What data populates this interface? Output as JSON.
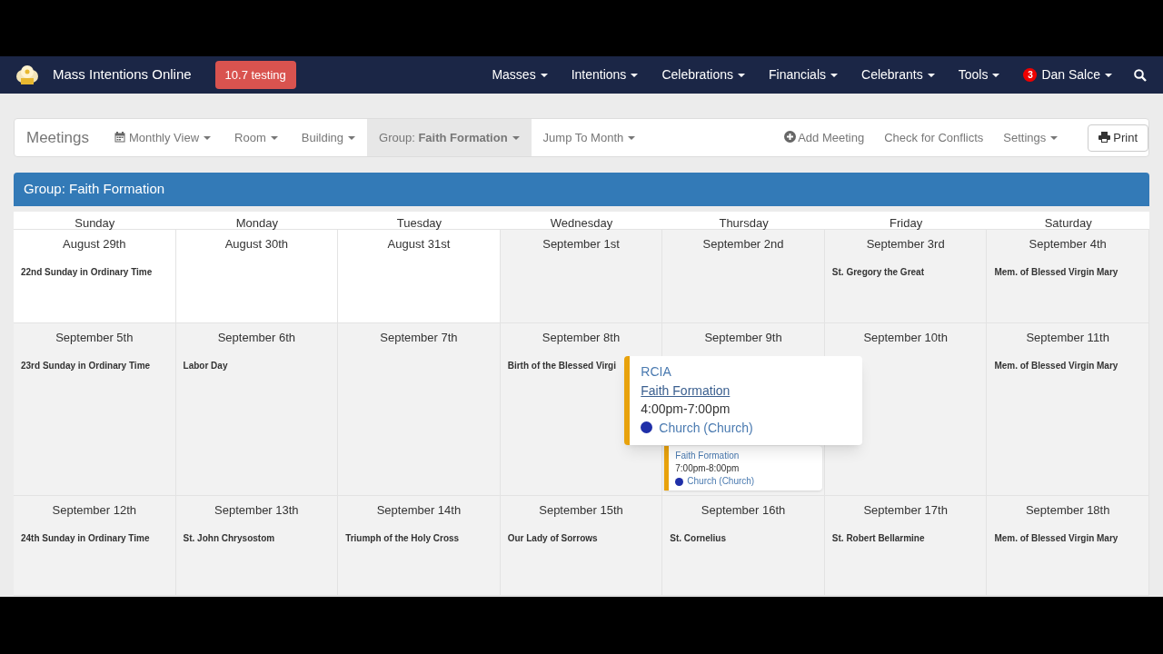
{
  "navbar": {
    "brand": "Mass Intentions Online",
    "version_badge": "10.7 testing",
    "menus": [
      {
        "label": "Masses"
      },
      {
        "label": "Intentions"
      },
      {
        "label": "Celebrations"
      },
      {
        "label": "Financials"
      },
      {
        "label": "Celebrants"
      },
      {
        "label": "Tools"
      }
    ],
    "user": {
      "notifications": "3",
      "name": "Dan Salce"
    }
  },
  "toolbar": {
    "title": "Meetings",
    "left_items": [
      {
        "label": "Monthly View",
        "kind": "dropdown",
        "selected": false
      },
      {
        "label": "Room",
        "kind": "dropdown",
        "selected": false
      },
      {
        "label": "Building",
        "kind": "dropdown",
        "selected": false
      },
      {
        "label": "Group: **Faith Formation**",
        "kind": "dropdown",
        "selected": true
      },
      {
        "label": "Jump To Month",
        "kind": "dropdown",
        "selected": false
      }
    ],
    "right_items": [
      {
        "label": "Add Meeting",
        "kind": "link"
      },
      {
        "label": "Check for Conflicts",
        "kind": "link"
      },
      {
        "label": "Settings",
        "kind": "dropdown"
      },
      {
        "label": "Print",
        "kind": "button"
      }
    ]
  },
  "panel_title": "Group: Faith Formation",
  "weekdays": [
    "Sunday",
    "Monday",
    "Tuesday",
    "Wednesday",
    "Thursday",
    "Friday",
    "Saturday"
  ],
  "weeks": [
    {
      "days": [
        {
          "date": "August 29th",
          "feast": "22nd Sunday in Ordinary Time",
          "shaded": false
        },
        {
          "date": "August 30th",
          "shaded": false
        },
        {
          "date": "August 31st",
          "shaded": false
        },
        {
          "date": "September 1st",
          "shaded": true
        },
        {
          "date": "September 2nd",
          "shaded": true
        },
        {
          "date": "September 3rd",
          "feast": "St. Gregory the Great",
          "shaded": true
        },
        {
          "date": "September 4th",
          "feast": "Mem. of Blessed Virgin Mary",
          "shaded": true
        }
      ]
    },
    {
      "days": [
        {
          "date": "September 5th",
          "feast": "23rd Sunday in Ordinary Time",
          "shaded": true
        },
        {
          "date": "September 6th",
          "feast": "Labor Day",
          "shaded": true
        },
        {
          "date": "September 7th",
          "shaded": true
        },
        {
          "date": "September 8th",
          "feast": "Birth of the Blessed Virgi",
          "shaded": true
        },
        {
          "date": "September 9th",
          "shaded": true,
          "events": [
            {
              "group": "Faith Formation",
              "time": "7:00pm-8:00pm",
              "location": "Church (Church)",
              "color": "#1f2fa8"
            }
          ],
          "popover": {
            "title": "RCIA",
            "group": "Faith Formation",
            "time": "4:00pm-7:00pm",
            "location": "Church (Church)",
            "color": "#1f2fa8"
          }
        },
        {
          "date": "September 10th",
          "shaded": true
        },
        {
          "date": "September 11th",
          "feast": "Mem. of Blessed Virgin Mary",
          "shaded": true
        }
      ]
    },
    {
      "days": [
        {
          "date": "September 12th",
          "feast": "24th Sunday in Ordinary Time",
          "shaded": true
        },
        {
          "date": "September 13th",
          "feast": "St. John Chrysostom",
          "shaded": true
        },
        {
          "date": "September 14th",
          "feast": "Triumph of the Holy Cross",
          "shaded": true
        },
        {
          "date": "September 15th",
          "feast": "Our Lady of Sorrows",
          "shaded": true
        },
        {
          "date": "September 16th",
          "feast": "St. Cornelius",
          "shaded": true
        },
        {
          "date": "September 17th",
          "feast": "St. Robert Bellarmine",
          "shaded": true
        },
        {
          "date": "September 18th",
          "feast": "Mem. of Blessed Virgin Mary",
          "shaded": true
        }
      ]
    }
  ]
}
